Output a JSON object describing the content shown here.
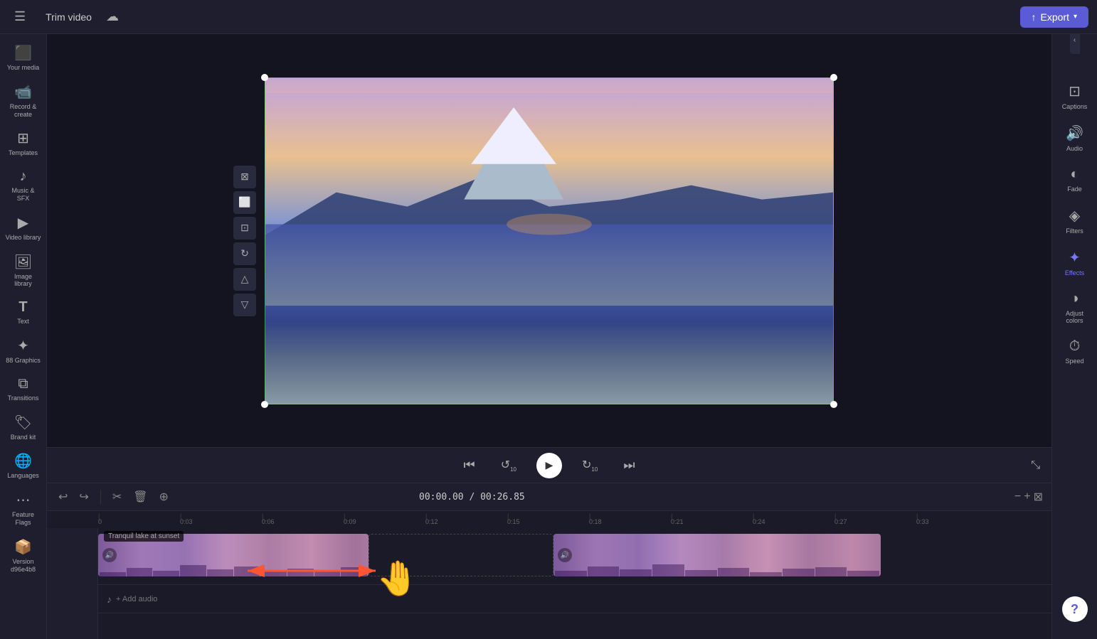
{
  "topbar": {
    "menu_icon": "☰",
    "title": "Trim video",
    "cloud_icon": "☁",
    "export_label": "Export",
    "export_icon": "↑",
    "chevron": "▾"
  },
  "left_sidebar": {
    "items": [
      {
        "id": "your-media",
        "icon": "⬛",
        "label": "Your media"
      },
      {
        "id": "record-create",
        "icon": "🎥",
        "label": "Record &\ncreate"
      },
      {
        "id": "templates",
        "icon": "⊞",
        "label": "Templates"
      },
      {
        "id": "music-sfx",
        "icon": "♪",
        "label": "Music & SFX"
      },
      {
        "id": "video-library",
        "icon": "▶",
        "label": "Video library"
      },
      {
        "id": "image-library",
        "icon": "🖼",
        "label": "Image library"
      },
      {
        "id": "text",
        "icon": "T",
        "label": "Text"
      },
      {
        "id": "graphics",
        "icon": "✦",
        "label": "88 Graphics"
      },
      {
        "id": "transitions",
        "icon": "⧉",
        "label": "Transitions"
      },
      {
        "id": "brand-kit",
        "icon": "🏷",
        "label": "Brand kit"
      },
      {
        "id": "languages",
        "icon": "🌐",
        "label": "Languages"
      },
      {
        "id": "feature-flags",
        "icon": "⋯",
        "label": "Feature Flags"
      },
      {
        "id": "version",
        "icon": "📦",
        "label": "Version d96e4b8"
      }
    ]
  },
  "video_tools": [
    {
      "id": "crop",
      "icon": "⊠"
    },
    {
      "id": "transform",
      "icon": "⬜"
    },
    {
      "id": "mirror",
      "icon": "⊡"
    },
    {
      "id": "rotate",
      "icon": "↻"
    },
    {
      "id": "flip-v",
      "icon": "△"
    },
    {
      "id": "flip-h",
      "icon": "▽"
    }
  ],
  "aspect_ratio": "16:9",
  "playback": {
    "skip_back": "⏮",
    "replay_10": "↺",
    "play": "▶",
    "forward_10": "↻",
    "skip_forward": "⏭",
    "timecode": "00:00.00",
    "duration": "00:26.85",
    "fullscreen": "⤡"
  },
  "timeline": {
    "undo": "↩",
    "redo": "↪",
    "cut": "✂",
    "delete": "🗑",
    "duplicate": "⊕",
    "timecode": "00:00.00 / 00:26.85",
    "zoom_out": "−",
    "zoom_in": "+",
    "fit": "⊠",
    "ruler_marks": [
      "0",
      "0:03",
      "0:06",
      "0:09",
      "0:12",
      "0:15",
      "0:18",
      "0:21",
      "0:24",
      "0:27",
      "0:33"
    ],
    "track_label": "Tranquil lake at sunset",
    "add_audio": "+ Add audio"
  },
  "right_sidebar": {
    "items": [
      {
        "id": "captions",
        "icon": "⊡",
        "label": "Captions",
        "active": false
      },
      {
        "id": "audio",
        "icon": "🔊",
        "label": "Audio",
        "active": false
      },
      {
        "id": "fade",
        "icon": "◐",
        "label": "Fade",
        "active": false
      },
      {
        "id": "filters",
        "icon": "◈",
        "label": "Filters",
        "active": false
      },
      {
        "id": "effects",
        "icon": "✦",
        "label": "Effects",
        "active": true
      },
      {
        "id": "adjust-colors",
        "icon": "◑",
        "label": "Adjust colors",
        "active": false
      },
      {
        "id": "speed",
        "icon": "⏱",
        "label": "Speed",
        "active": false
      }
    ]
  }
}
